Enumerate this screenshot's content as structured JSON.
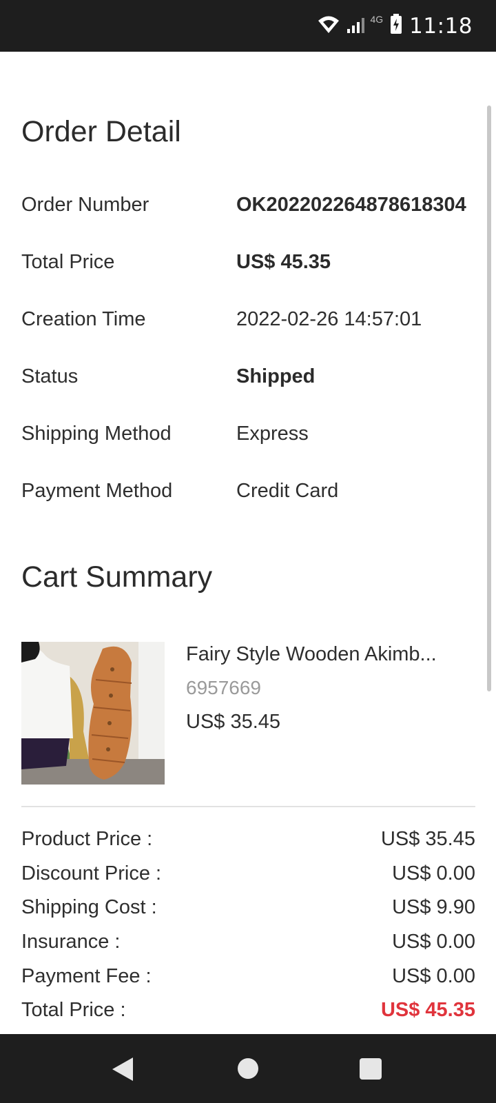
{
  "status_bar": {
    "time": "11:18",
    "network": "4G"
  },
  "order_detail": {
    "title": "Order Detail",
    "rows": [
      {
        "label": "Order Number",
        "value": "OK202202264878618304"
      },
      {
        "label": "Total Price",
        "value": "US$ 45.35"
      },
      {
        "label": "Creation Time",
        "value": "2022-02-26 14:57:01"
      },
      {
        "label": "Status",
        "value": "Shipped"
      },
      {
        "label": "Shipping Method",
        "value": "Express"
      },
      {
        "label": "Payment Method",
        "value": "Credit Card"
      }
    ]
  },
  "cart_summary": {
    "title": "Cart Summary",
    "item": {
      "name": "Fairy Style Wooden Akimb...",
      "sku": "6957669",
      "price": "US$ 35.45"
    },
    "totals": [
      {
        "label": "Product Price :",
        "value": "US$ 35.45"
      },
      {
        "label": "Discount Price :",
        "value": "US$ 0.00"
      },
      {
        "label": "Shipping Cost :",
        "value": "US$ 9.90"
      },
      {
        "label": "Insurance :",
        "value": "US$ 0.00"
      },
      {
        "label": "Payment Fee :",
        "value": "US$ 0.00"
      },
      {
        "label": "Total Price :",
        "value": "US$ 45.35"
      }
    ]
  },
  "colors": {
    "total_accent": "#e0343c",
    "bar_background": "#1e1e1e"
  },
  "icons": [
    "wifi-icon",
    "signal-icon",
    "battery-icon",
    "back-icon",
    "home-icon",
    "recents-icon"
  ]
}
